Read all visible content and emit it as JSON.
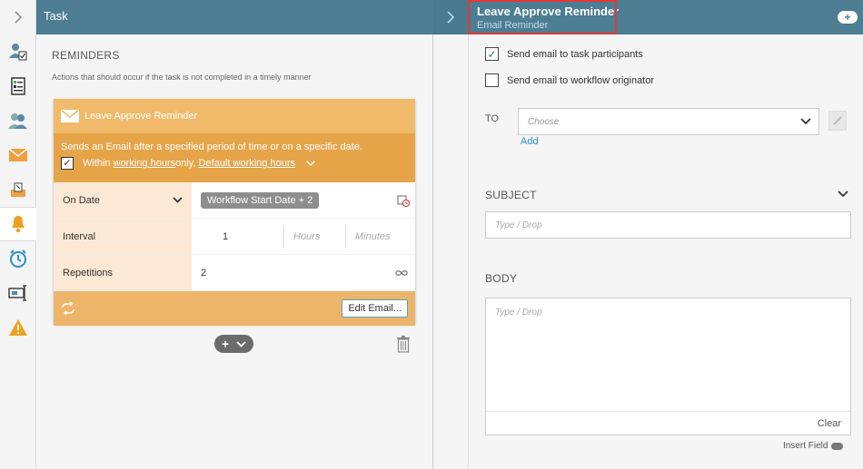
{
  "left_header": {
    "title": "Task"
  },
  "reminders": {
    "title": "REMINDERS",
    "description": "Actions that should occur if the task is not completed in a timely manner",
    "card": {
      "title": "Leave Approve Reminder",
      "desc": "Sends an Email after a specified period of time or on a specific date.",
      "within_prefix": "Within ",
      "working_hours_link": "working hours",
      "only_text": " only, ",
      "default_hours_link": "Default working hours",
      "on_date_label": "On Date",
      "on_date_value": "Workflow Start Date + 2",
      "interval_label": "Interval",
      "interval_value": "1",
      "hours_placeholder": "Hours",
      "minutes_placeholder": "Minutes",
      "repetitions_label": "Repetitions",
      "repetitions_value": "2",
      "edit_email_label": "Edit Email..."
    }
  },
  "right_header": {
    "title": "Leave Approve Reminder",
    "subtitle": "Email Reminder"
  },
  "email": {
    "send_participants_label": "Send email to task participants",
    "send_participants_checked": true,
    "send_originator_label": "Send email to workflow originator",
    "send_originator_checked": false,
    "to_label": "TO",
    "to_placeholder": "Choose",
    "add_label": "Add",
    "subject_label": "SUBJECT",
    "subject_placeholder": "Type / Drop",
    "body_label": "BODY",
    "body_placeholder": "Type / Drop",
    "clear_label": "Clear",
    "insert_field_label": "Insert Field"
  },
  "colors": {
    "header": "#4c7d93",
    "card_head": "#f0ba6a",
    "card_desc": "#e6a449",
    "link": "#2a8fc9",
    "highlight": "#e53935"
  },
  "rail_icons": [
    "chevron-right-icon",
    "user-task-icon",
    "form-icon",
    "users-icon",
    "email-icon",
    "inbox-icon",
    "bell-icon",
    "alarm-clock-icon",
    "rename-icon",
    "warning-icon"
  ]
}
